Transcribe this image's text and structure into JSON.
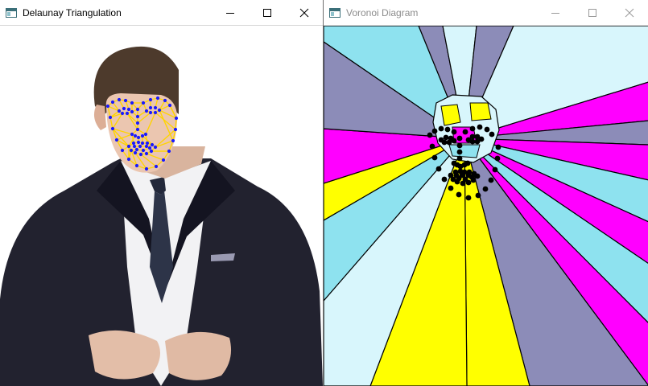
{
  "windows": {
    "delaunay": {
      "title": "Delaunay Triangulation",
      "icon": "app-window-icon",
      "active": true
    },
    "voronoi": {
      "title": "Voronoi Diagram",
      "icon": "app-window-icon",
      "active": false
    }
  },
  "controls": [
    "minimize-icon",
    "maximize-icon",
    "close-icon"
  ],
  "colors": {
    "triangulation_edges": "#ffd400",
    "landmark_points": "#1a1aff",
    "voronoi_points": "#000000",
    "voronoi_palette": [
      "#ff00ff",
      "#ffff00",
      "#8c8cb8",
      "#d8f6fc",
      "#8ee2ef"
    ]
  }
}
